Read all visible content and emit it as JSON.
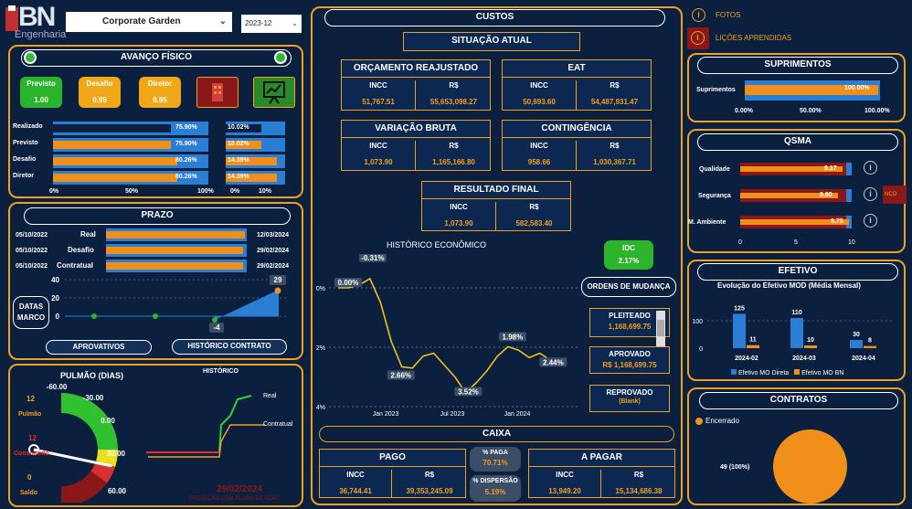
{
  "logo": {
    "text": "BN",
    "sub": "Engenharia"
  },
  "filters": {
    "project": "Corporate Garden",
    "period": "2023-12"
  },
  "links": {
    "fotos": "FOTOS",
    "licoes": "LIÇÕES APRENDIDAS"
  },
  "avanco": {
    "title": "AVANÇO FÍSICO",
    "cards": [
      {
        "label": "Previsto",
        "value": "1.00"
      },
      {
        "label": "Desafio",
        "value": "0.95"
      },
      {
        "label": "Diretor",
        "value": "0.95"
      }
    ],
    "rows": [
      {
        "label": "Realizado",
        "v1": "75.90%",
        "v2": "10.02%"
      },
      {
        "label": "Previsto",
        "v1": "75.90%",
        "v2": "10.02%"
      },
      {
        "label": "Desafio",
        "v1": "80.26%",
        "v2": "14.39%"
      },
      {
        "label": "Diretor",
        "v1": "80.26%",
        "v2": "14.39%"
      }
    ],
    "axis1": [
      "0%",
      "50%",
      "100%"
    ],
    "axis2": [
      "0%",
      "10%"
    ]
  },
  "prazo": {
    "title": "PRAZO",
    "rows": [
      {
        "start": "05/10/2022",
        "label": "Real",
        "end": "12/03/2024"
      },
      {
        "start": "05/10/2022",
        "label": "Desafio",
        "end": "29/02/2024"
      },
      {
        "start": "05/10/2022",
        "label": "Contratual",
        "end": "29/02/2024"
      }
    ],
    "yaxis": [
      "40",
      "20",
      "0"
    ],
    "marco_label": "DATAS MARCO",
    "min_label": "-4",
    "max_label": "29",
    "btn_aprov": "APROVATIVOS",
    "btn_hist": "HISTÓRICO CONTRATO"
  },
  "pulmao": {
    "title": "PULMÃO (DIAS)",
    "ticks": [
      "-60.00",
      "-30.00",
      "0.00",
      "30.00",
      "60.00"
    ],
    "pulmao_val": "12",
    "pulmao_lbl": "Pulmão",
    "consumido_val": "12",
    "consumido_lbl": "Consumido",
    "saldo_val": "0",
    "saldo_lbl": "Saldo",
    "hist_title": "HISTÓRICO",
    "legend_real": "Real",
    "legend_contratual": "Contratual",
    "date": "29/02/2024",
    "proj": "PROJEÇÃO COM PLANO DE AÇÃO"
  },
  "custos": {
    "title": "CUSTOS",
    "situacao": "SITUAÇÃO ATUAL",
    "orc": {
      "title": "ORÇAMENTO REAJUSTADO",
      "incc_l": "INCC",
      "incc": "51,767.51",
      "rs_l": "R$",
      "rs": "55,653,098.27"
    },
    "eat": {
      "title": "EAT",
      "incc_l": "INCC",
      "incc": "50,693.60",
      "rs_l": "R$",
      "rs": "54,487,931.47"
    },
    "var": {
      "title": "VARIAÇÃO BRUTA",
      "incc_l": "INCC",
      "incc": "1,073.90",
      "rs_l": "R$",
      "rs": "1,165,166.80"
    },
    "cont": {
      "title": "CONTINGÊNCIA",
      "incc_l": "INCC",
      "incc": "958.66",
      "rs_l": "R$",
      "rs": "1,030,367.71"
    },
    "res": {
      "title": "RESULTADO FINAL",
      "incc_l": "INCC",
      "incc": "1,073.90",
      "rs_l": "R$",
      "rs": "582,583.40"
    },
    "hist_title": "HISTÓRICO ECONÔMICO",
    "idc_label": "IDC",
    "idc_value": "2.17%",
    "ordens": "ORDENS DE MUDANÇA",
    "pleiteado_l": "PLEITEADO",
    "pleiteado": "1,168,699.75",
    "aprovado_l": "APROVADO",
    "aprovado": "R$ 1,168,699.75",
    "reprovado_l": "REPROVADO",
    "reprovado": "(Blank)"
  },
  "caixa": {
    "title": "CAIXA",
    "pago": {
      "title": "PAGO",
      "incc_l": "INCC",
      "incc": "36,744.41",
      "rs_l": "R$",
      "rs": "39,353,245.09"
    },
    "apagar": {
      "title": "A PAGAR",
      "incc_l": "INCC",
      "incc": "13,949.20",
      "rs_l": "R$",
      "rs": "15,134,686.38"
    },
    "paga_l": "% PAGA",
    "paga": "70.71%",
    "disp_l": "% DISPERSÃO",
    "disp": "5.19%"
  },
  "suprimentos": {
    "title": "SUPRIMENTOS",
    "label": "Suprimentos",
    "value": "100.00%",
    "axis": [
      "0.00%",
      "50.00%",
      "100.00%"
    ]
  },
  "qsma": {
    "title": "QSMA",
    "rows": [
      {
        "label": "Qualidade",
        "value": "9.17"
      },
      {
        "label": "Segurança",
        "value": "8.80"
      },
      {
        "label": "M. Ambiente",
        "value": "9.75"
      }
    ],
    "axis": [
      "0",
      "5",
      "10"
    ]
  },
  "efetivo": {
    "title": "EFETIVO",
    "subtitle": "Evolução do Efetivo MOD (Média Mensal)",
    "yaxis": [
      "100",
      "0"
    ],
    "legend": [
      "Efetivo MO Direta",
      "Efetivo MO BN"
    ]
  },
  "contratos": {
    "title": "CONTRATOS",
    "legend": "Encerrado",
    "label": "49 (100%)"
  },
  "colors": {
    "accent": "#f0a020",
    "bg": "#0b1f3e",
    "blue": "#2a7fd4",
    "green": "#2db42d"
  },
  "chart_data": [
    {
      "type": "line",
      "title": "HISTÓRICO ECONÔMICO",
      "x_ticks": [
        "Jan 2023",
        "Jul 2023",
        "Jan 2024"
      ],
      "y_ticks": [
        "0%",
        "2%",
        "4%"
      ],
      "series": [
        {
          "values": [
            0.0,
            0.0,
            -0.1,
            -0.31,
            0.5,
            1.8,
            2.66,
            2.7,
            2.3,
            2.2,
            2.6,
            3.0,
            3.52,
            3.2,
            2.8,
            2.3,
            1.98,
            2.1,
            2.35,
            2.2,
            2.44,
            2.44
          ]
        }
      ],
      "labels": [
        "0.00%",
        "-0.31%",
        "2.66%",
        "3.52%",
        "1.98%",
        "2.44%"
      ]
    },
    {
      "type": "bar",
      "title": "Evolução do Efetivo MOD (Média Mensal)",
      "categories": [
        "2024-02",
        "2024-03",
        "2024-04"
      ],
      "series": [
        {
          "name": "Efetivo MO Direta",
          "values": [
            125,
            110,
            30
          ]
        },
        {
          "name": "Efetivo MO BN",
          "values": [
            11,
            10,
            8
          ]
        }
      ]
    },
    {
      "type": "pie",
      "categories": [
        "Encerrado"
      ],
      "values": [
        49
      ]
    },
    {
      "type": "area",
      "x_ticks": [],
      "y_ticks": [
        "40",
        "20",
        "0"
      ],
      "series": [
        {
          "values": [
            0,
            0,
            0,
            0,
            0,
            -4,
            29
          ]
        }
      ]
    }
  ]
}
